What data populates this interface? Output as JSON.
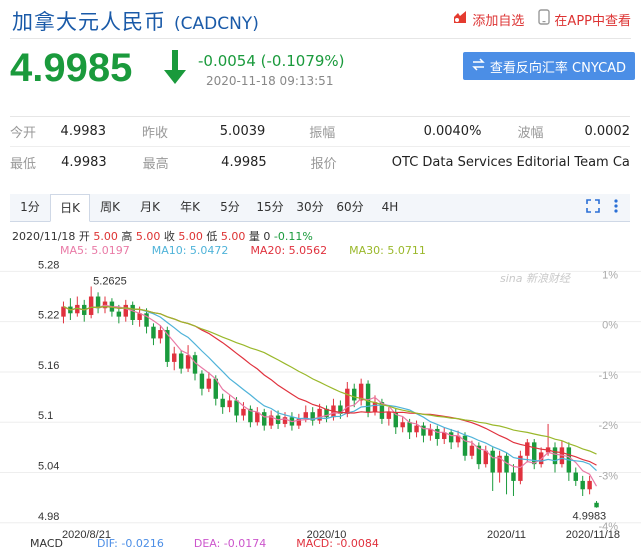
{
  "header": {
    "title": "加拿大元人民币",
    "code": "(CADCNY)",
    "add_watch": "添加自选",
    "app_view": "在APP中查看"
  },
  "quote": {
    "price": "4.9985",
    "change": "-0.0054 (-0.1079%)",
    "time": "2020-11-18 09:13:51",
    "reverse_label": "查看反向汇率 CNYCAD"
  },
  "stats": [
    [
      {
        "l": "今开",
        "v": "4.9983"
      },
      {
        "l": "昨收",
        "v": "5.0039"
      },
      {
        "l": "振幅",
        "v": "0.0040%"
      },
      {
        "l": "波幅",
        "v": "0.0002"
      }
    ],
    [
      {
        "l": "最低",
        "v": "4.9983"
      },
      {
        "l": "最高",
        "v": "4.9985"
      },
      {
        "l": "报价",
        "v": "OTC Data Services Editorial Team Calc..."
      }
    ]
  ],
  "tabs": [
    "1分",
    "日K",
    "周K",
    "月K",
    "年K",
    "5分",
    "15分",
    "30分",
    "60分",
    "4H"
  ],
  "active_tab": "日K",
  "info": {
    "date": "2020/11/18",
    "open_l": "开",
    "open": "5.00",
    "high_l": "高",
    "high": "5.00",
    "close_l": "收",
    "close": "5.00",
    "low_l": "低",
    "low": "5.00",
    "vol_l": "量",
    "vol": "0",
    "pct": "-0.11%"
  },
  "ma": {
    "ma5": "MA5: 5.0197",
    "ma10": "MA10: 5.0472",
    "ma20": "MA20: 5.0562",
    "ma30": "MA30: 5.0711"
  },
  "macd": {
    "title": "MACD",
    "dif": "DIF: -0.0216",
    "dea": "DEA: -0.0174",
    "macd": "MACD: -0.0084"
  },
  "watermark": "sina 新浪财经",
  "colors": {
    "up": "#e0323e",
    "down": "#1a9a3c",
    "ma5": "#e97aa6",
    "ma10": "#4fb3d9",
    "ma20": "#e0323e",
    "ma30": "#9ab82b"
  },
  "chart_data": {
    "type": "candlestick",
    "y_ticks": [
      "5.28",
      "5.22",
      "5.16",
      "5.1",
      "5.04",
      "4.98"
    ],
    "y_values": [
      5.28,
      5.22,
      5.16,
      5.1,
      5.04,
      4.98
    ],
    "pct_ticks": [
      "1%",
      "0%",
      "-1%",
      "-2%",
      "-3%",
      "-4%"
    ],
    "x_labels": [
      "2020/8/21",
      "2020/10",
      "2020/11",
      "2020/11/18"
    ],
    "x_label_index": [
      0,
      38,
      64,
      77
    ],
    "ylim": [
      4.975,
      5.29
    ],
    "max_label": "5.2625",
    "max_index": 4,
    "last_label": "4.9983",
    "candles": [
      [
        5.226,
        5.238,
        5.244,
        5.218
      ],
      [
        5.238,
        5.23,
        5.248,
        5.222
      ],
      [
        5.23,
        5.24,
        5.25,
        5.226
      ],
      [
        5.24,
        5.228,
        5.246,
        5.22
      ],
      [
        5.228,
        5.25,
        5.262,
        5.224
      ],
      [
        5.25,
        5.236,
        5.255,
        5.23
      ],
      [
        5.236,
        5.244,
        5.25,
        5.23
      ],
      [
        5.244,
        5.232,
        5.248,
        5.226
      ],
      [
        5.232,
        5.226,
        5.24,
        5.218
      ],
      [
        5.226,
        5.24,
        5.246,
        5.22
      ],
      [
        5.24,
        5.222,
        5.244,
        5.216
      ],
      [
        5.222,
        5.23,
        5.238,
        5.214
      ],
      [
        5.23,
        5.214,
        5.236,
        5.206
      ],
      [
        5.214,
        5.2,
        5.218,
        5.192
      ],
      [
        5.2,
        5.21,
        5.216,
        5.194
      ],
      [
        5.21,
        5.172,
        5.214,
        5.166
      ],
      [
        5.172,
        5.182,
        5.19,
        5.162
      ],
      [
        5.182,
        5.164,
        5.186,
        5.158
      ],
      [
        5.164,
        5.18,
        5.192,
        5.16
      ],
      [
        5.18,
        5.158,
        5.184,
        5.15
      ],
      [
        5.158,
        5.14,
        5.162,
        5.132
      ],
      [
        5.14,
        5.152,
        5.16,
        5.136
      ],
      [
        5.152,
        5.128,
        5.156,
        5.12
      ],
      [
        5.128,
        5.118,
        5.134,
        5.11
      ],
      [
        5.118,
        5.126,
        5.132,
        5.112
      ],
      [
        5.126,
        5.108,
        5.13,
        5.1
      ],
      [
        5.108,
        5.116,
        5.124,
        5.102
      ],
      [
        5.116,
        5.1,
        5.12,
        5.094
      ],
      [
        5.1,
        5.112,
        5.118,
        5.096
      ],
      [
        5.112,
        5.096,
        5.116,
        5.09
      ],
      [
        5.096,
        5.108,
        5.114,
        5.092
      ],
      [
        5.108,
        5.098,
        5.114,
        5.092
      ],
      [
        5.098,
        5.106,
        5.112,
        5.094
      ],
      [
        5.106,
        5.096,
        5.112,
        5.09
      ],
      [
        5.096,
        5.104,
        5.11,
        5.092
      ],
      [
        5.104,
        5.112,
        5.12,
        5.1
      ],
      [
        5.112,
        5.102,
        5.118,
        5.096
      ],
      [
        5.102,
        5.116,
        5.122,
        5.098
      ],
      [
        5.116,
        5.106,
        5.12,
        5.1
      ],
      [
        5.106,
        5.12,
        5.128,
        5.102
      ],
      [
        5.12,
        5.11,
        5.126,
        5.104
      ],
      [
        5.11,
        5.14,
        5.148,
        5.106
      ],
      [
        5.14,
        5.126,
        5.146,
        5.118
      ],
      [
        5.126,
        5.146,
        5.152,
        5.12
      ],
      [
        5.146,
        5.112,
        5.15,
        5.106
      ],
      [
        5.112,
        5.124,
        5.132,
        5.108
      ],
      [
        5.124,
        5.104,
        5.128,
        5.098
      ],
      [
        5.104,
        5.112,
        5.118,
        5.096
      ],
      [
        5.112,
        5.094,
        5.116,
        5.086
      ],
      [
        5.094,
        5.1,
        5.106,
        5.088
      ],
      [
        5.1,
        5.088,
        5.104,
        5.08
      ],
      [
        5.088,
        5.096,
        5.102,
        5.082
      ],
      [
        5.096,
        5.084,
        5.1,
        5.076
      ],
      [
        5.084,
        5.092,
        5.098,
        5.078
      ],
      [
        5.092,
        5.08,
        5.096,
        5.072
      ],
      [
        5.08,
        5.088,
        5.094,
        5.074
      ],
      [
        5.088,
        5.076,
        5.092,
        5.068
      ],
      [
        5.076,
        5.084,
        5.09,
        5.07
      ],
      [
        5.084,
        5.06,
        5.088,
        5.054
      ],
      [
        5.06,
        5.072,
        5.078,
        5.056
      ],
      [
        5.072,
        5.05,
        5.076,
        5.044
      ],
      [
        5.05,
        5.066,
        5.072,
        5.046
      ],
      [
        5.066,
        5.04,
        5.07,
        5.018
      ],
      [
        5.04,
        5.06,
        5.066,
        5.028
      ],
      [
        5.06,
        5.04,
        5.064,
        5.014
      ],
      [
        5.04,
        5.03,
        5.05,
        5.012
      ],
      [
        5.03,
        5.06,
        5.066,
        5.026
      ],
      [
        5.06,
        5.076,
        5.08,
        5.052
      ],
      [
        5.076,
        5.05,
        5.08,
        5.044
      ],
      [
        5.05,
        5.064,
        5.07,
        5.046
      ],
      [
        5.064,
        5.07,
        5.098,
        5.06
      ],
      [
        5.07,
        5.05,
        5.076,
        5.04
      ],
      [
        5.05,
        5.07,
        5.078,
        5.046
      ],
      [
        5.07,
        5.04,
        5.076,
        5.03
      ],
      [
        5.04,
        5.03,
        5.046,
        5.024
      ],
      [
        5.03,
        5.02,
        5.036,
        5.012
      ],
      [
        5.02,
        5.03,
        5.036,
        5.014
      ],
      [
        5.0039,
        4.9985,
        5.006,
        4.998
      ]
    ]
  }
}
